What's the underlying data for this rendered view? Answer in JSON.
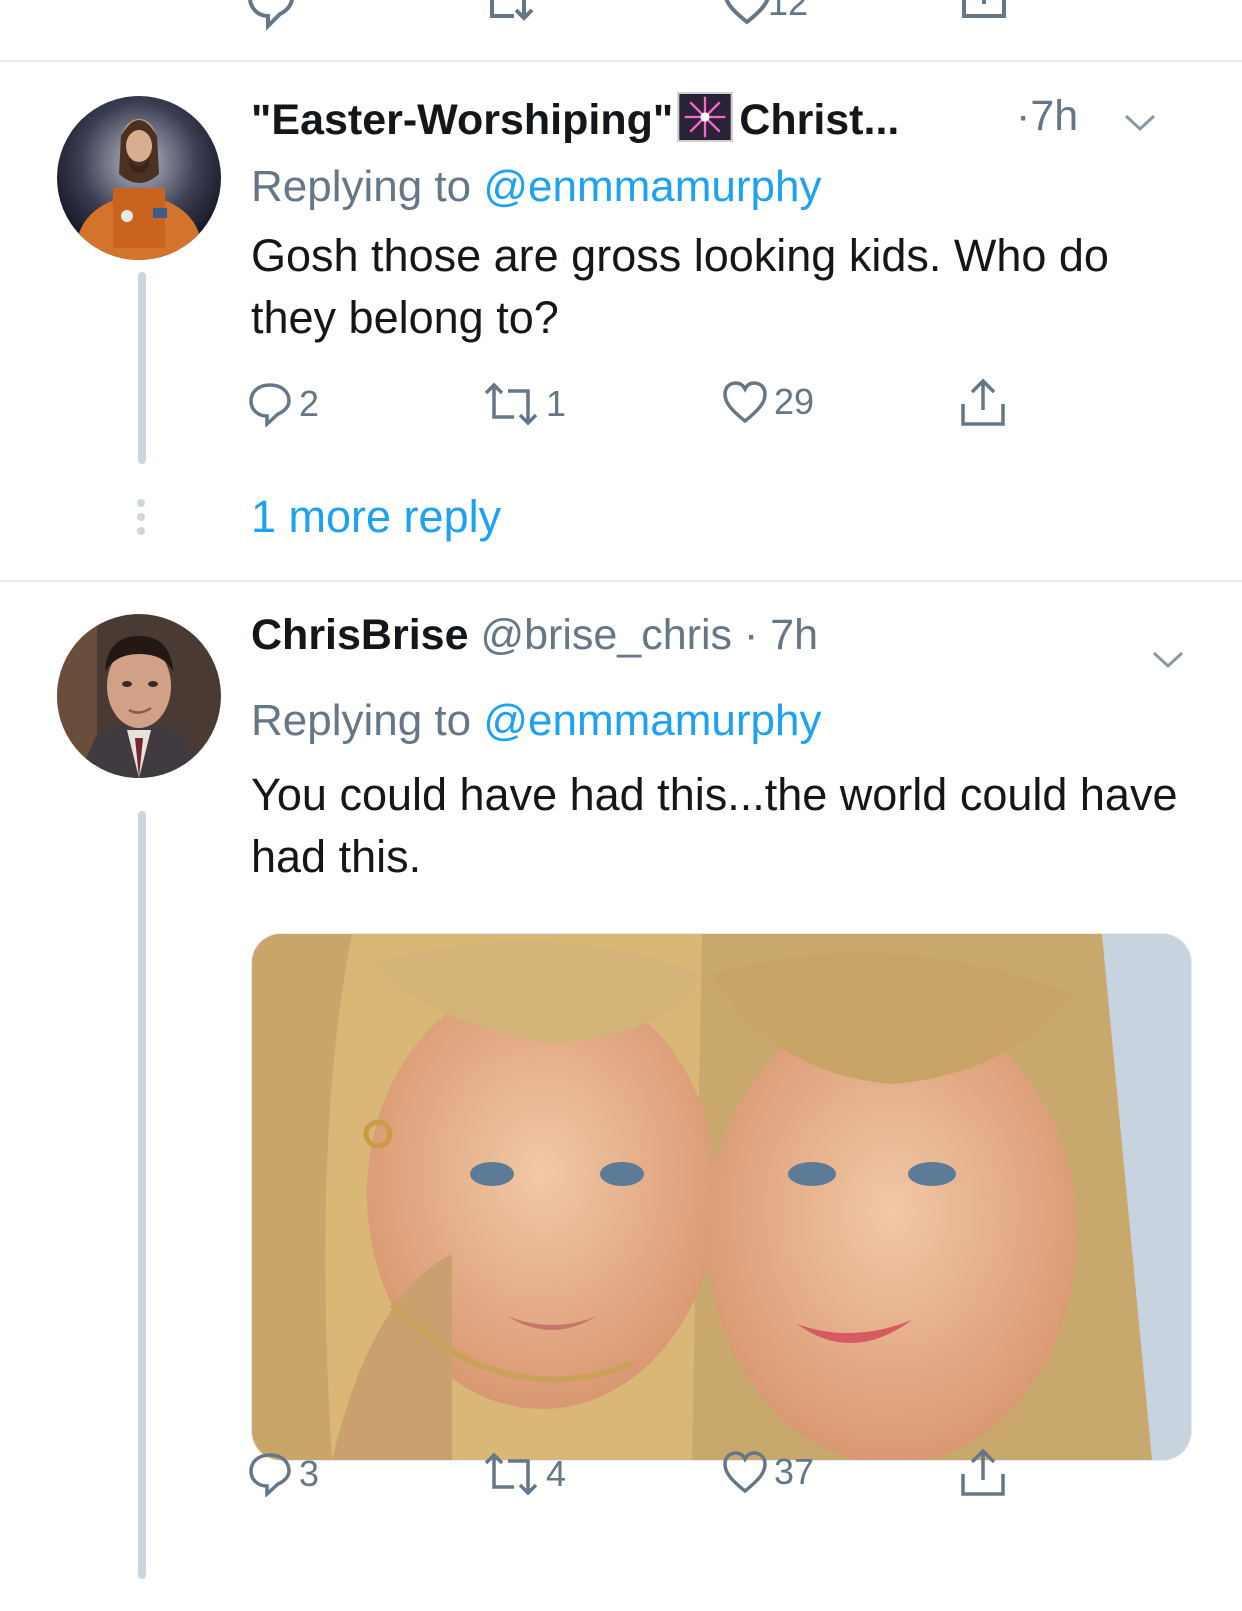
{
  "top_row": {
    "like_count_partial": "12"
  },
  "tweets": [
    {
      "name": "\"Easter-Worshiping\"",
      "name_suffix": "Christ...",
      "time": "7h",
      "replying_prefix": "Replying to",
      "replying_to": "@enmmamurphy",
      "text": "Gosh those are gross looking kids. Who do they belong to?",
      "replies": "2",
      "retweets": "1",
      "likes": "29"
    },
    {
      "name": "ChrisBrise",
      "handle": "@brise_chris",
      "time": "7h",
      "replying_prefix": "Replying to",
      "replying_to": "@enmmamurphy",
      "text": "You could have had this...the world could have had this.",
      "replies": "3",
      "retweets": "4",
      "likes": "37"
    }
  ],
  "more_reply": "1 more reply",
  "icons": {
    "reply": "reply-icon",
    "retweet": "retweet-icon",
    "like": "heart-icon",
    "share": "share-icon",
    "caret": "chevron-down-icon",
    "name_emoji": "firework-emoji-icon"
  },
  "colors": {
    "link": "#1da1f2",
    "secondary_text": "#657786",
    "thread_line": "#ccd6dd",
    "divider": "#e6ecf0"
  }
}
